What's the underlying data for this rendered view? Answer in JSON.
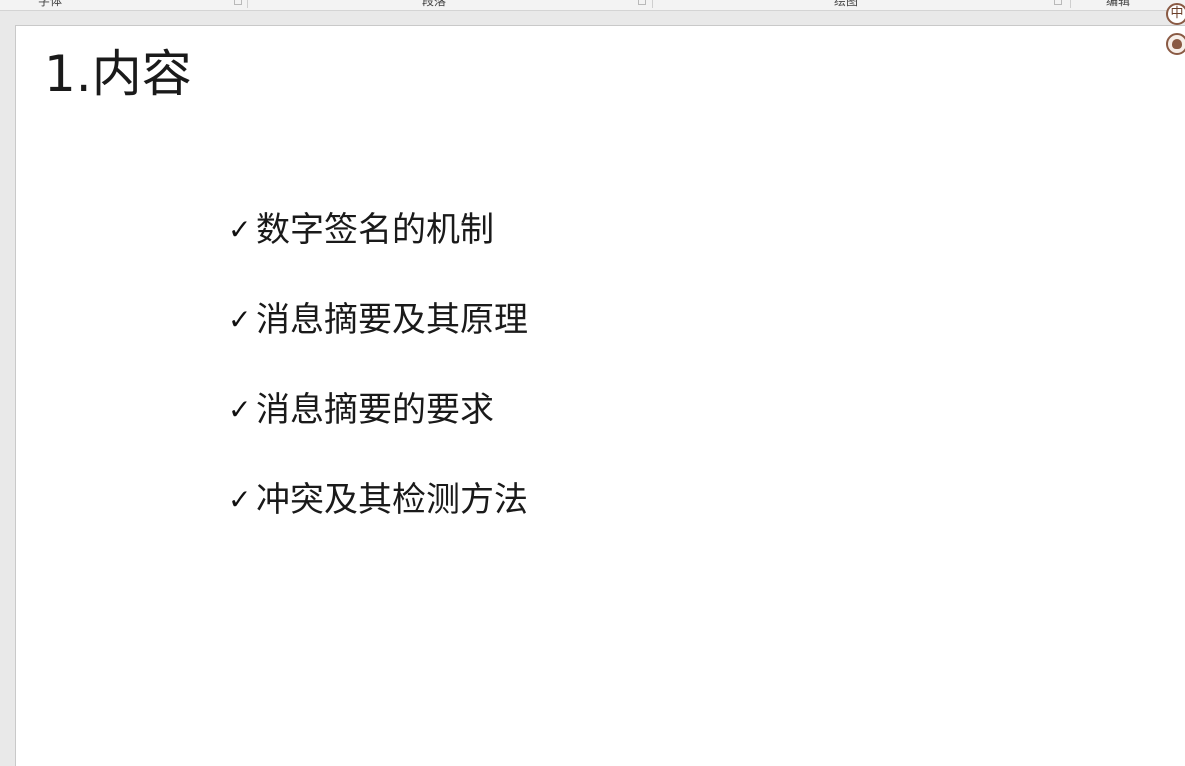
{
  "ribbon": {
    "groups": [
      {
        "label": "字体"
      },
      {
        "label": "段落"
      },
      {
        "label": "绘图"
      },
      {
        "label": "编辑"
      }
    ]
  },
  "slide": {
    "title": "1.内容",
    "bullets": [
      {
        "check": "✓",
        "text": "数字签名的机制"
      },
      {
        "check": "✓",
        "text": "消息摘要及其原理"
      },
      {
        "check": "✓",
        "text": "消息摘要的要求"
      },
      {
        "check": "✓",
        "text": "冲突及其检测方法"
      }
    ]
  },
  "ime": {
    "language_label": "中",
    "mascot_icon": "squirrel-mascot-icon"
  }
}
